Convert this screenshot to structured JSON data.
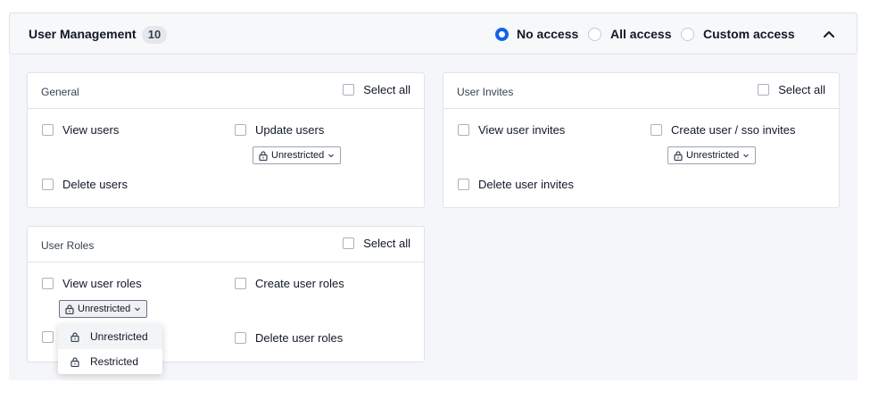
{
  "header": {
    "title": "User Management",
    "count": "10",
    "access_options": [
      {
        "label": "No access",
        "checked": true
      },
      {
        "label": "All access",
        "checked": false
      },
      {
        "label": "Custom access",
        "checked": false
      }
    ]
  },
  "cards": {
    "general": {
      "title": "General",
      "select_all": "Select all",
      "perms": {
        "view_users": "View users",
        "update_users": "Update users",
        "update_users_scope": "Unrestricted",
        "delete_users": "Delete users"
      }
    },
    "user_invites": {
      "title": "User Invites",
      "select_all": "Select all",
      "perms": {
        "view_invites": "View user invites",
        "create_invites": "Create user / sso invites",
        "create_invites_scope": "Unrestricted",
        "delete_invites": "Delete user invites"
      }
    },
    "user_roles": {
      "title": "User Roles",
      "select_all": "Select all",
      "perms": {
        "view_roles": "View user roles",
        "view_roles_scope": "Unrestricted",
        "create_roles": "Create user roles",
        "delete_roles": "Delete user roles"
      }
    }
  },
  "dropdown": {
    "options": [
      "Unrestricted",
      "Restricted"
    ],
    "selected": "Unrestricted"
  },
  "colors": {
    "accent": "#1163e6",
    "border": "#dfe3e8",
    "panel_bg": "#f4f6f9"
  }
}
